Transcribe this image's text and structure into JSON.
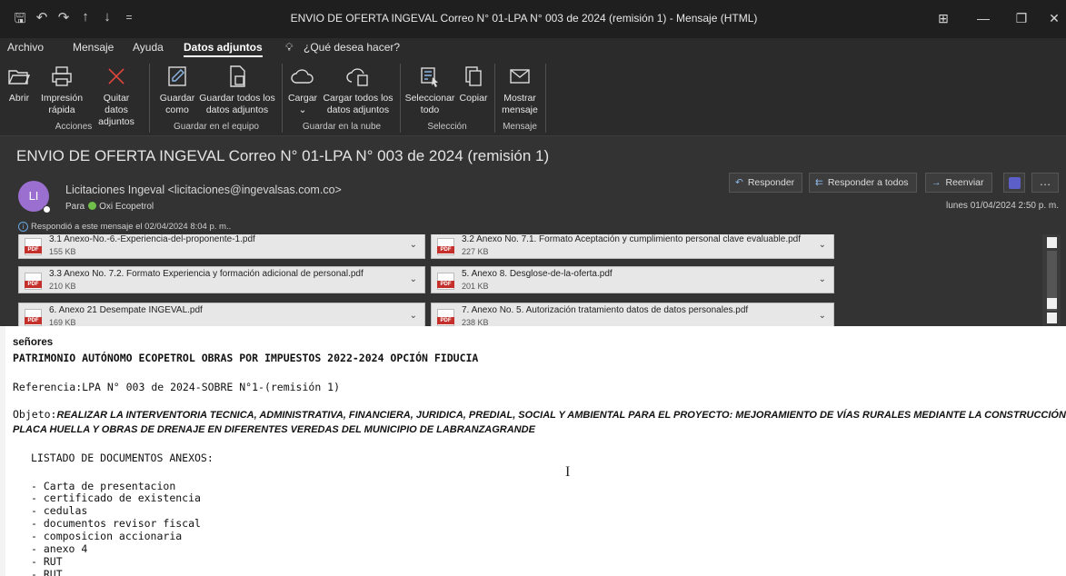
{
  "titlebar": {
    "title": "ENVIO DE OFERTA INGEVAL Correo N° 01-LPA N° 003 de 2024 (remisión 1)  -  Mensaje (HTML)",
    "quick_access": [
      "🖫",
      "↶",
      "↷",
      "↑",
      "↓",
      "="
    ],
    "controls": [
      "⊞",
      "—",
      "❐",
      "✕"
    ]
  },
  "menubar": {
    "items": [
      "Archivo",
      "Mensaje",
      "Ayuda",
      "Datos adjuntos"
    ],
    "search": "¿Qué desea hacer?"
  },
  "ribbon": {
    "acciones": {
      "label": "Acciones",
      "abrir": "Abrir",
      "impresion": "Impresión rápida",
      "quitar": "Quitar datos adjuntos"
    },
    "equipo": {
      "label": "Guardar en el equipo",
      "guardar_como": "Guardar como",
      "guardar_todos": "Guardar todos los datos adjuntos"
    },
    "nube": {
      "label": "Guardar en la nube",
      "cargar": "Cargar",
      "cargar_todos": "Cargar todos los datos adjuntos"
    },
    "seleccion": {
      "label": "Selección",
      "seleccionar_todo": "Seleccionar todo",
      "copiar": "Copiar"
    },
    "mensaje": {
      "label": "Mensaje",
      "mostrar": "Mostrar mensaje"
    }
  },
  "header": {
    "subject": "ENVIO DE OFERTA INGEVAL Correo N° 01-LPA N° 003 de 2024 (remisión 1)",
    "avatar_initials": "LI",
    "sender": "Licitaciones Ingeval <licitaciones@ingevalsas.com.co>",
    "to_prefix": "Para",
    "to_name": "Oxi Ecopetrol",
    "replied": "Respondió a este mensaje el 02/04/2024 8:04 p. m..",
    "date": "lunes 01/04/2024 2:50 p. m.",
    "actions": {
      "responder": "Responder",
      "responder_todos": "Responder a todos",
      "reenviar": "Reenviar"
    }
  },
  "attachments": [
    {
      "name": "3.1 Anexo-No.-6.-Experiencia-del-proponente-1.pdf",
      "size": "155 KB"
    },
    {
      "name": "3.2 Anexo No. 7.1. Formato Aceptación y cumplimiento personal clave evaluable.pdf",
      "size": "227 KB"
    },
    {
      "name": "3.3 Anexo No. 7.2. Formato Experiencia y formación adicional de personal.pdf",
      "size": "210 KB"
    },
    {
      "name": "5. Anexo 8. Desglose-de-la-oferta.pdf",
      "size": "201 KB"
    },
    {
      "name": "6. Anexo 21  Desempate INGEVAL.pdf",
      "size": "169 KB"
    },
    {
      "name": "7. Anexo No. 5. Autorización tratamiento datos de datos personales.pdf",
      "size": "238 KB"
    }
  ],
  "body": {
    "greeting": "señores",
    "addressee": "PATRIMONIO AUTÓNOMO ECOPETROL OBRAS POR IMPUESTOS 2022-2024 OPCIÓN FIDUCIA",
    "referencia": "Referencia:LPA N° 003 de 2024-SOBRE N°1-(remisión 1)",
    "objeto_prefix": "Objeto:",
    "objeto_line1": "REALIZAR  LA INTERVENTORIA TECNICA, ADMINISTRATIVA, FINANCIERA, JURIDICA, PREDIAL, SOCIAL Y AMBIENTAL PARA EL PROYECTO: MEJORAMIENTO DE VÍAS RURALES MEDIANTE LA CONSTRUCCIÓN DE",
    "objeto_line2": "PLACA HUELLA Y OBRAS DE DRENAJE EN DIFERENTES VEREDAS DEL MUNICIPIO DE LABRANZAGRANDE",
    "listado_title": "LISTADO DE DOCUMENTOS ANEXOS:",
    "items": [
      "- Carta de presentacion",
      "- certificado de existencia",
      "- cedulas",
      "- documentos revisor fiscal",
      "- composicion accionaria",
      "- anexo 4",
      "- RUT",
      "- RUT"
    ]
  }
}
